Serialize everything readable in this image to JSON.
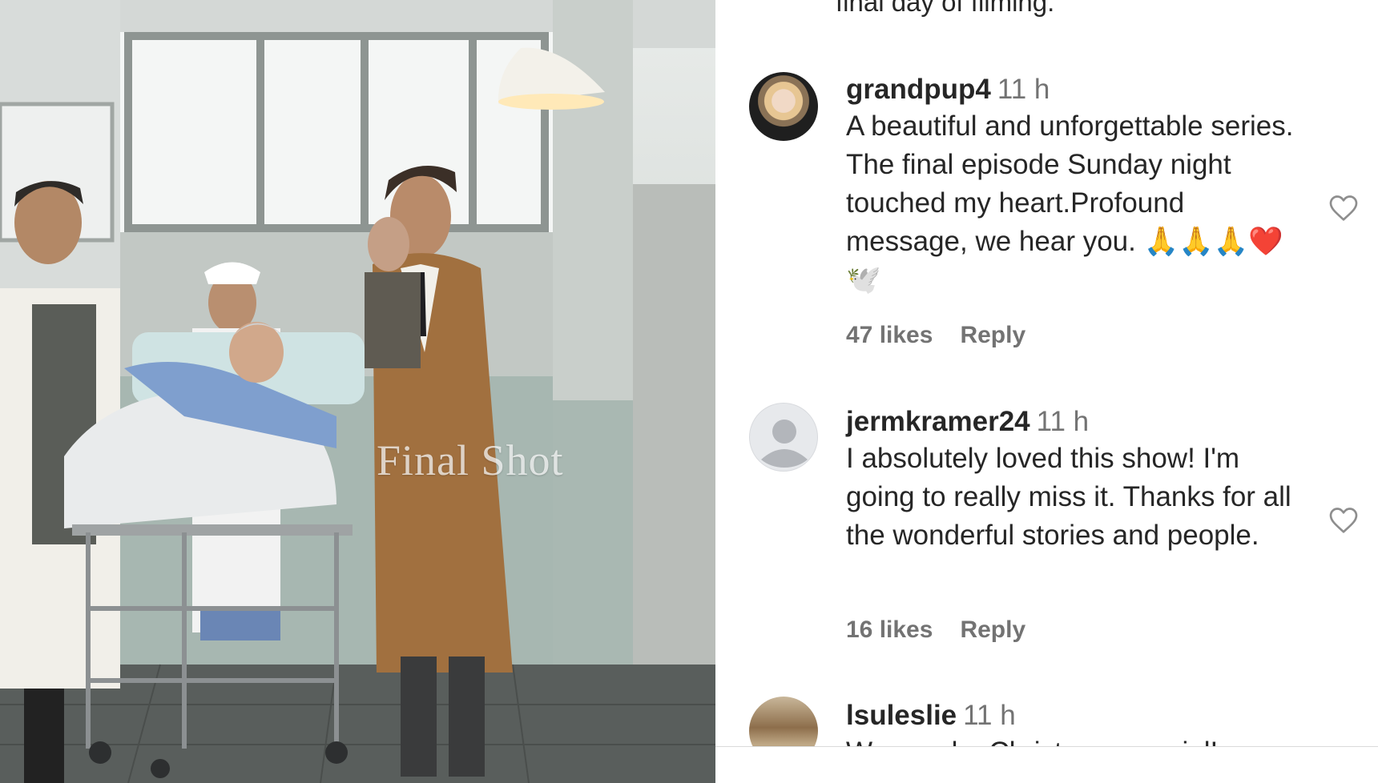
{
  "media": {
    "watermark": "Final Shot"
  },
  "caption": {
    "tail_text": "final day of filming."
  },
  "comments": [
    {
      "username": "grandpup4",
      "time": "11 h",
      "text": "A beautiful and unforgettable series. The final episode Sunday night touched my heart.Profound message, we hear you. 🙏🙏🙏❤️ 🕊️",
      "likes": "47 likes",
      "reply_label": "Reply",
      "avatar": "profile-photo"
    },
    {
      "username": "jermkramer24",
      "time": "11 h",
      "text": "I absolutely loved this show! I'm going to really miss it. Thanks for all the wonderful stories and people.",
      "likes": "16 likes",
      "reply_label": "Reply",
      "avatar": "default-avatar"
    },
    {
      "username": "lsuleslie",
      "time": "11 h",
      "text": "We need a Christmas special!",
      "avatar": "profile-photo"
    }
  ],
  "colors": {
    "text_primary": "#262626",
    "text_secondary": "#737373",
    "divider": "#dbdbdb"
  },
  "icons": {
    "like": "heart-outline-icon",
    "default_avatar": "person-silhouette-icon"
  }
}
